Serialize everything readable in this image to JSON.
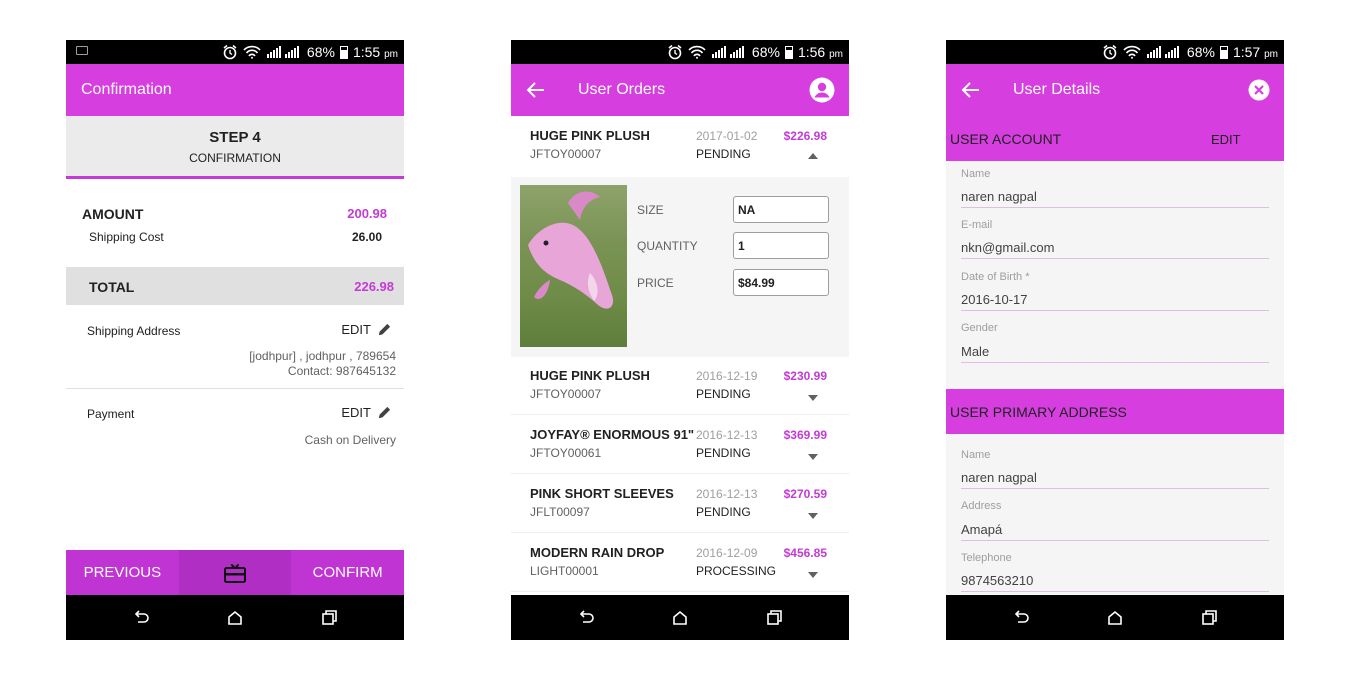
{
  "colors": {
    "accent": "#d63ee0",
    "price": "#c43ad6",
    "status_bar": "#000000"
  },
  "status_bars": [
    {
      "battery": "68%",
      "time": "1:55",
      "ampm": "pm"
    },
    {
      "battery": "68%",
      "time": "1:56",
      "ampm": "pm"
    },
    {
      "battery": "68%",
      "time": "1:57",
      "ampm": "pm"
    }
  ],
  "confirmation": {
    "title": "Confirmation",
    "step_title": "STEP 4",
    "step_sub": "CONFIRMATION",
    "amount_label": "AMOUNT",
    "amount_value": "200.98",
    "shipping_cost_label": "Shipping Cost",
    "shipping_cost_value": "26.00",
    "total_label": "TOTAL",
    "total_value": "226.98",
    "shipping_address_label": "Shipping Address",
    "edit_label": "EDIT",
    "address_line1": "[jodhpur] , jodhpur , 789654",
    "address_line2": "Contact: 987645132",
    "payment_label": "Payment",
    "payment_value": "Cash on Delivery",
    "previous_label": "PREVIOUS",
    "confirm_label": "CONFIRM",
    "mid_icon": "gift-card-icon"
  },
  "orders": {
    "title": "User Orders",
    "back_icon": "arrow-back-icon",
    "account_icon": "account-circle-icon",
    "items": [
      {
        "name": "HUGE PINK PLUSH",
        "sku": "JFTOY00007",
        "date": "2017-01-02",
        "status": "PENDING",
        "price": "$226.98",
        "expanded": true
      },
      {
        "name": "HUGE PINK PLUSH",
        "sku": "JFTOY00007",
        "date": "2016-12-19",
        "status": "PENDING",
        "price": "$230.99",
        "expanded": false
      },
      {
        "name": "JOYFAY® ENORMOUS 91\"",
        "sku": "JFTOY00061",
        "date": "2016-12-13",
        "status": "PENDING",
        "price": "$369.99",
        "expanded": false
      },
      {
        "name": "PINK SHORT SLEEVES",
        "sku": "JFLT00097",
        "date": "2016-12-13",
        "status": "PENDING",
        "price": "$270.59",
        "expanded": false
      },
      {
        "name": "MODERN RAIN DROP",
        "sku": "LIGHT00001",
        "date": "2016-12-09",
        "status": "PROCESSING",
        "price": "$456.85",
        "expanded": false
      }
    ],
    "detail": {
      "size_label": "SIZE",
      "size_value": "NA",
      "quantity_label": "QUANTITY",
      "quantity_value": "1",
      "price_label": "PRICE",
      "price_value": "$84.99"
    }
  },
  "user_details": {
    "title": "User Details",
    "close_icon": "close-circle-icon",
    "account_section": "USER ACCOUNT",
    "edit_label": "EDIT",
    "account_fields": [
      {
        "label": "Name",
        "value": "naren nagpal"
      },
      {
        "label": "E-mail",
        "value": "nkn@gmail.com"
      },
      {
        "label": "Date of Birth *",
        "value": "2016-10-17"
      },
      {
        "label": "Gender",
        "value": "Male"
      }
    ],
    "address_section": "USER PRIMARY ADDRESS",
    "address_fields": [
      {
        "label": "Name",
        "value": "naren nagpal"
      },
      {
        "label": "Address",
        "value": "Amapá"
      },
      {
        "label": "Telephone",
        "value": "9874563210"
      }
    ]
  }
}
